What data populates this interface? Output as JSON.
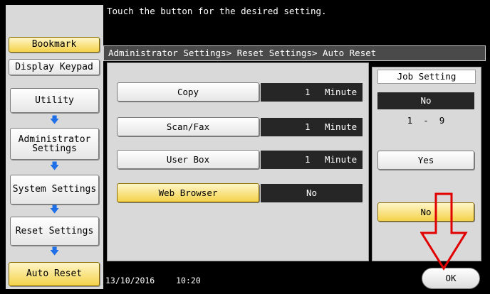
{
  "message": "Touch the button for the desired setting.",
  "breadcrumb": "Administrator Settings> Reset Settings> Auto Reset",
  "sidebar": {
    "bookmark": "Bookmark",
    "display_keypad": "Display Keypad",
    "items": [
      {
        "label": "Utility"
      },
      {
        "label": "Administrator Settings"
      },
      {
        "label": "System Settings"
      },
      {
        "label": "Reset Settings"
      },
      {
        "label": "Auto Reset"
      }
    ]
  },
  "settings": [
    {
      "label": "Copy",
      "value_num": "1",
      "value_unit": "Minute"
    },
    {
      "label": "Scan/Fax",
      "value_num": "1",
      "value_unit": "Minute"
    },
    {
      "label": "User Box",
      "value_num": "1",
      "value_unit": "Minute"
    },
    {
      "label": "Web Browser",
      "value": "No"
    }
  ],
  "job_setting": {
    "title": "Job Setting",
    "current_value": "No",
    "range": "1  -  9",
    "yes": "Yes",
    "no": "No"
  },
  "footer": {
    "date": "13/10/2016",
    "time": "10:20",
    "ok": "OK"
  },
  "colors": {
    "highlight_yellow": "#f4d24a",
    "arrow_blue": "#1f6fe8",
    "annotation_red": "#e10000"
  },
  "icons": {
    "sidebar_arrow": "arrow-down",
    "annotation": "red-down-arrow"
  }
}
